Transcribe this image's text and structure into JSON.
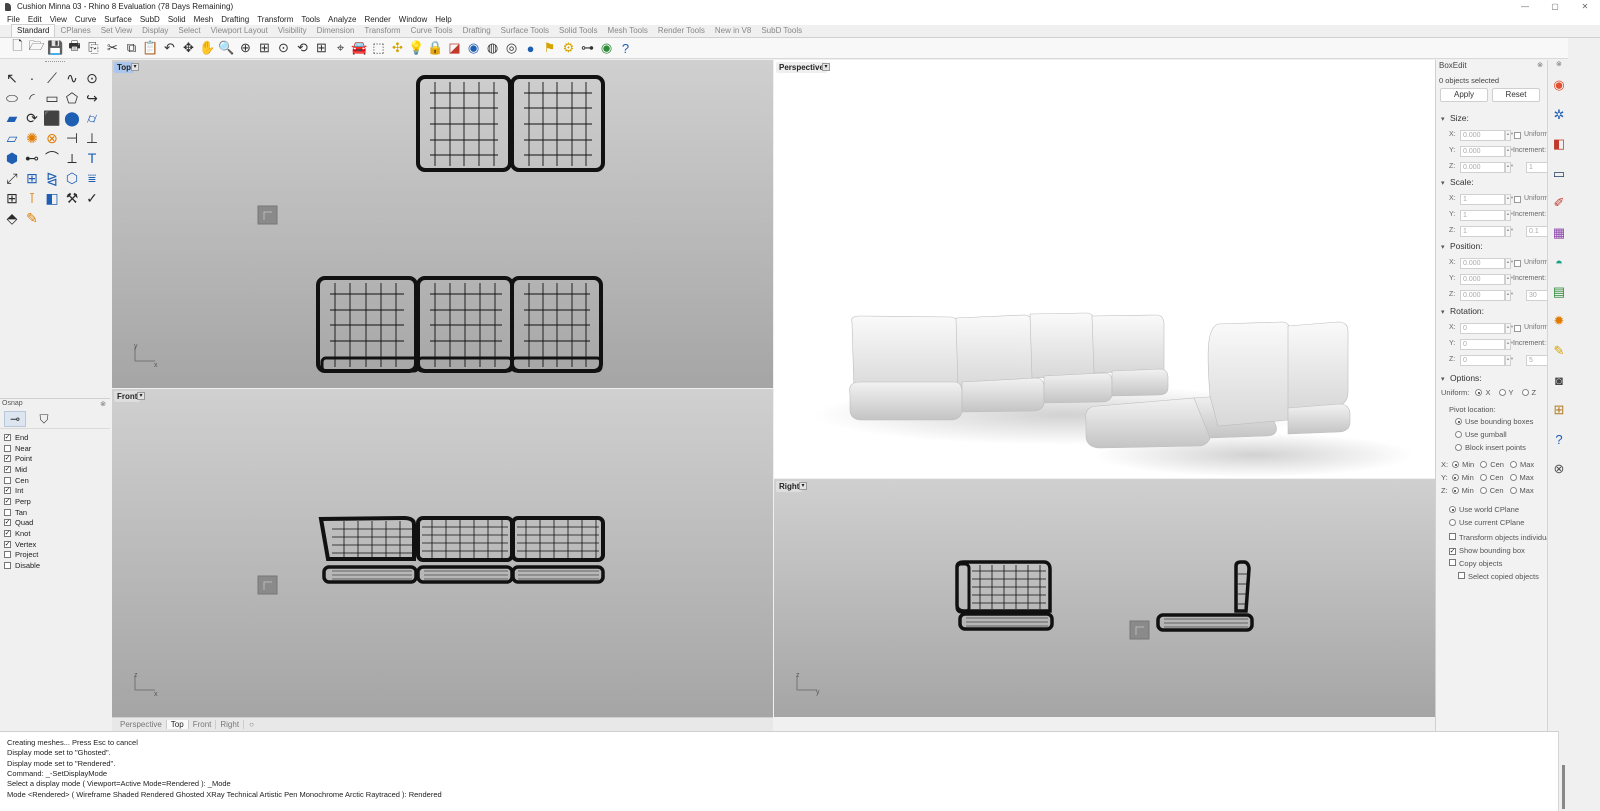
{
  "window": {
    "title": "Cushion Minna 03 - Rhino 8 Evaluation (78 Days Remaining)",
    "controls": {
      "minimize": "—",
      "maximize": "▢",
      "close": "✕"
    }
  },
  "menu": [
    "File",
    "Edit",
    "View",
    "Curve",
    "Surface",
    "SubD",
    "Solid",
    "Mesh",
    "Drafting",
    "Transform",
    "Tools",
    "Analyze",
    "Render",
    "Window",
    "Help"
  ],
  "tabs": [
    "Standard",
    "CPlanes",
    "Set View",
    "Display",
    "Select",
    "Viewport Layout",
    "Visibility",
    "Dimension",
    "Transform",
    "Curve Tools",
    "Drafting",
    "Surface Tools",
    "Solid Tools",
    "Mesh Tools",
    "Render Tools",
    "New in V8",
    "SubD Tools"
  ],
  "active_tab": "Standard",
  "toolbar_icons": [
    {
      "name": "new-file-icon",
      "glyph": "🗋"
    },
    {
      "name": "open-folder-icon",
      "glyph": "🗁"
    },
    {
      "name": "save-icon",
      "glyph": "💾"
    },
    {
      "name": "print-icon",
      "glyph": "🖶"
    },
    {
      "name": "import-icon",
      "glyph": "⎘"
    },
    {
      "name": "cut-icon",
      "glyph": "✂"
    },
    {
      "name": "copy-icon",
      "glyph": "⧉"
    },
    {
      "name": "paste-icon",
      "glyph": "📋"
    },
    {
      "name": "undo-icon",
      "glyph": "↶"
    },
    {
      "name": "pan-icon",
      "glyph": "✥"
    },
    {
      "name": "hand-icon",
      "glyph": "✋"
    },
    {
      "name": "zoom-icon",
      "glyph": "🔍"
    },
    {
      "name": "zoom-window-icon",
      "glyph": "⊕"
    },
    {
      "name": "zoom-extents-icon",
      "glyph": "⊞"
    },
    {
      "name": "zoom-selected-icon",
      "glyph": "⊙"
    },
    {
      "name": "rotate-view-icon",
      "glyph": "⟲"
    },
    {
      "name": "viewport-layout-icon",
      "glyph": "⊞"
    },
    {
      "name": "set-cplane-icon",
      "glyph": "⌖"
    },
    {
      "name": "car-icon",
      "glyph": "🚘",
      "color": "red"
    },
    {
      "name": "select-icon",
      "glyph": "⬚"
    },
    {
      "name": "points-icon",
      "glyph": "✣",
      "color": "yellow"
    },
    {
      "name": "light-icon",
      "glyph": "💡"
    },
    {
      "name": "lock-icon",
      "glyph": "🔒"
    },
    {
      "name": "layers-icon",
      "glyph": "◪",
      "color": "red"
    },
    {
      "name": "color-wheel-icon",
      "glyph": "◉",
      "color": "blue"
    },
    {
      "name": "display-mode-icon",
      "glyph": "◍"
    },
    {
      "name": "render-sphere-icon",
      "glyph": "◎"
    },
    {
      "name": "globe-icon",
      "glyph": "●",
      "color": "blue"
    },
    {
      "name": "snap-icon",
      "glyph": "⚑",
      "color": "yellow"
    },
    {
      "name": "settings-icon",
      "glyph": "⚙",
      "color": "yellow"
    },
    {
      "name": "dimension-icon",
      "glyph": "⊶"
    },
    {
      "name": "rhino-globe-icon",
      "glyph": "◉",
      "color": "green"
    },
    {
      "name": "help-icon",
      "glyph": "?",
      "color": "blue"
    }
  ],
  "left_tools": [
    {
      "name": "select-arrow-icon",
      "glyph": "↖"
    },
    {
      "name": "point-icon",
      "glyph": "·"
    },
    {
      "name": "polyline-icon",
      "glyph": "⟋"
    },
    {
      "name": "curve-icon",
      "glyph": "∿"
    },
    {
      "name": "circle-icon",
      "glyph": "⊙"
    },
    {
      "name": "ellipse-icon",
      "glyph": "⬭"
    },
    {
      "name": "arc-icon",
      "glyph": "◜"
    },
    {
      "name": "rectangle-icon",
      "glyph": "▭"
    },
    {
      "name": "polygon-icon",
      "glyph": "⬠"
    },
    {
      "name": "curve-fillet-icon",
      "glyph": "↪"
    },
    {
      "name": "surface-icon",
      "glyph": "▰",
      "color": "blue"
    },
    {
      "name": "revolve-icon",
      "glyph": "⟳"
    },
    {
      "name": "box-icon",
      "glyph": "⬛",
      "color": "blue"
    },
    {
      "name": "sphere-icon",
      "glyph": "⬤",
      "color": "blue"
    },
    {
      "name": "cylinder-icon",
      "glyph": "⌭",
      "color": "blue"
    },
    {
      "name": "extrude-icon",
      "glyph": "▱",
      "color": "blue"
    },
    {
      "name": "mesh-icon",
      "glyph": "✺",
      "color": "orange"
    },
    {
      "name": "boolean-icon",
      "glyph": "⊗",
      "color": "orange"
    },
    {
      "name": "split-icon",
      "glyph": "⊣"
    },
    {
      "name": "trim-icon",
      "glyph": "⊥"
    },
    {
      "name": "solid-tools-icon",
      "glyph": "⬢",
      "color": "blue"
    },
    {
      "name": "join-icon",
      "glyph": "⊷"
    },
    {
      "name": "fillet-edge-icon",
      "glyph": "⌒"
    },
    {
      "name": "explode-icon",
      "glyph": "⟂"
    },
    {
      "name": "text-icon",
      "glyph": "T",
      "color": "blue"
    },
    {
      "name": "move-icon",
      "glyph": "⤢"
    },
    {
      "name": "array-icon",
      "glyph": "⊞",
      "color": "blue"
    },
    {
      "name": "mirror-icon",
      "glyph": "⧎",
      "color": "blue"
    },
    {
      "name": "cage-edit-icon",
      "glyph": "⬡",
      "color": "blue"
    },
    {
      "name": "flow-icon",
      "glyph": "⩸",
      "color": "blue"
    },
    {
      "name": "grid-array-icon",
      "glyph": "⊞"
    },
    {
      "name": "dimension-tool-icon",
      "glyph": "⊺",
      "color": "orange"
    },
    {
      "name": "analysis-icon",
      "glyph": "◧",
      "color": "blue"
    },
    {
      "name": "gumball-icon",
      "glyph": "⚒"
    },
    {
      "name": "check-icon",
      "glyph": "✓"
    },
    {
      "name": "block-icon",
      "glyph": "⬘"
    },
    {
      "name": "paint-icon",
      "glyph": "✎",
      "color": "orange"
    }
  ],
  "osnap": {
    "title": "Osnap",
    "pin": "⊗",
    "items": [
      {
        "label": "End",
        "checked": true
      },
      {
        "label": "Near",
        "checked": false
      },
      {
        "label": "Point",
        "checked": true
      },
      {
        "label": "Mid",
        "checked": true
      },
      {
        "label": "Cen",
        "checked": false
      },
      {
        "label": "Int",
        "checked": true
      },
      {
        "label": "Perp",
        "checked": true
      },
      {
        "label": "Tan",
        "checked": false
      },
      {
        "label": "Quad",
        "checked": true
      },
      {
        "label": "Knot",
        "checked": true
      },
      {
        "label": "Vertex",
        "checked": true
      },
      {
        "label": "Project",
        "checked": false
      },
      {
        "label": "Disable",
        "checked": false
      }
    ]
  },
  "viewports": {
    "top": {
      "label": "Top",
      "active": true,
      "axis_a": "y",
      "axis_b": "x"
    },
    "front": {
      "label": "Front",
      "axis_a": "z",
      "axis_b": "x"
    },
    "perspective": {
      "label": "Perspective"
    },
    "right": {
      "label": "Right",
      "axis_a": "z",
      "axis_b": "y"
    },
    "arrow": "▾"
  },
  "viewport_tabs": [
    "Perspective",
    "Top",
    "Front",
    "Right"
  ],
  "viewport_tab_active": "Top",
  "viewport_tab_add": "○",
  "command_history": [
    "Creating meshes... Press Esc to cancel",
    "Display mode set to \"Ghosted\".",
    "Display mode set to \"Rendered\".",
    "Command: _-SetDisplayMode",
    "Select a display mode ( Viewport=Active  Mode=Rendered ): _Mode",
    "Mode <Rendered> ( Wireframe  Shaded  Rendered  Ghosted  XRay  Technical  Artistic  Pen  Monochrome  Arctic  Raytraced ): Rendered"
  ],
  "boxedit": {
    "title": "BoxEdit",
    "pin": "⊗",
    "selected": "0 objects selected",
    "apply": "Apply",
    "reset": "Reset",
    "size": {
      "label": "Size:",
      "x": "0.000",
      "y": "0.000",
      "z": "0.000",
      "uniform": "Uniform",
      "increment_label": "Increment:",
      "increment": "1"
    },
    "scale": {
      "label": "Scale:",
      "x": "1",
      "y": "1",
      "z": "1",
      "uniform": "Uniform",
      "increment_label": "Increment:",
      "increment": "0.1"
    },
    "position": {
      "label": "Position:",
      "x": "0.000",
      "y": "0.000",
      "z": "0.000",
      "uniform": "Uniform",
      "increment_label": "Increment:",
      "increment": "30"
    },
    "rotation": {
      "label": "Rotation:",
      "x": "0",
      "y": "0",
      "z": "0",
      "uniform": "Uniform",
      "increment_label": "Increment:",
      "increment": "5"
    },
    "axis_x": "X:",
    "axis_y": "Y:",
    "axis_z": "Z:",
    "options": {
      "label": "Options:",
      "uniform_label": "Uniform:",
      "ux": "X",
      "uy": "Y",
      "uz": "Z",
      "pivot_label": "Pivot location:",
      "pivot_bbox": "Use bounding boxes",
      "pivot_gumball": "Use gumball",
      "pivot_block": "Block insert points",
      "min": "Min",
      "cen": "Cen",
      "max": "Max",
      "use_world": "Use world CPlane",
      "use_current": "Use current CPlane",
      "transform_individually": "Transform objects individually",
      "show_bbox": "Show bounding box",
      "copy_objects": "Copy objects",
      "select_copied": "Select copied objects"
    }
  },
  "right_strip_icons": [
    {
      "name": "properties-color-icon",
      "glyph": "◉",
      "color": "#e05030"
    },
    {
      "name": "layer-settings-icon",
      "glyph": "✲",
      "color": "#1e5fb3"
    },
    {
      "name": "layers-panel-icon",
      "glyph": "◧",
      "color": "#c0392b"
    },
    {
      "name": "display-panel-icon",
      "glyph": "▭",
      "color": "#1e3a5f"
    },
    {
      "name": "brush-icon",
      "glyph": "✐",
      "color": "#c0392b"
    },
    {
      "name": "materials-icon",
      "glyph": "▦",
      "color": "#8e44ad"
    },
    {
      "name": "environment-icon",
      "glyph": "◓",
      "color": "#16a085"
    },
    {
      "name": "ground-plane-icon",
      "glyph": "▤",
      "color": "#2e8b3a"
    },
    {
      "name": "sun-icon",
      "glyph": "✹",
      "color": "#e07b00"
    },
    {
      "name": "lights-icon",
      "glyph": "✎",
      "color": "#d4a300"
    },
    {
      "name": "named-views-icon",
      "glyph": "◙",
      "color": "#444"
    },
    {
      "name": "libraries-icon",
      "glyph": "⊞",
      "color": "#b07a20"
    },
    {
      "name": "help-panel-icon",
      "glyph": "?",
      "color": "#1e5fb3"
    },
    {
      "name": "shapes-icon",
      "glyph": "⊗",
      "color": "#555"
    }
  ]
}
